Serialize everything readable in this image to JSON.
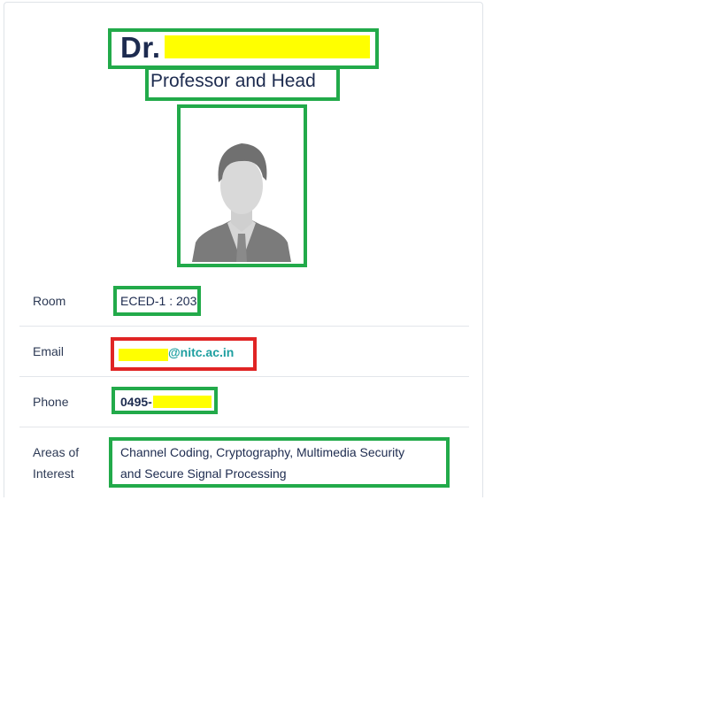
{
  "profile": {
    "name_prefix": "Dr.",
    "title": "Professor and Head",
    "photo_icon": "person-silhouette-icon"
  },
  "details": {
    "room_label": "Room",
    "room_value": "ECED-1 : 203",
    "email_label": "Email",
    "email_domain": "@nitc.ac.in",
    "phone_label": "Phone",
    "phone_prefix": "0495-",
    "interest_label_line1": "Areas of",
    "interest_label_line2": "Interest",
    "interest_line1": "Channel Coding, Cryptography, Multimedia Security",
    "interest_line2": "and Secure Signal Processing"
  },
  "colors": {
    "annotation_ok": "#22aa4a",
    "annotation_error": "#e02424",
    "redaction": "#ffff00",
    "link": "#1e9fa0",
    "heading": "#1d2b4f"
  }
}
